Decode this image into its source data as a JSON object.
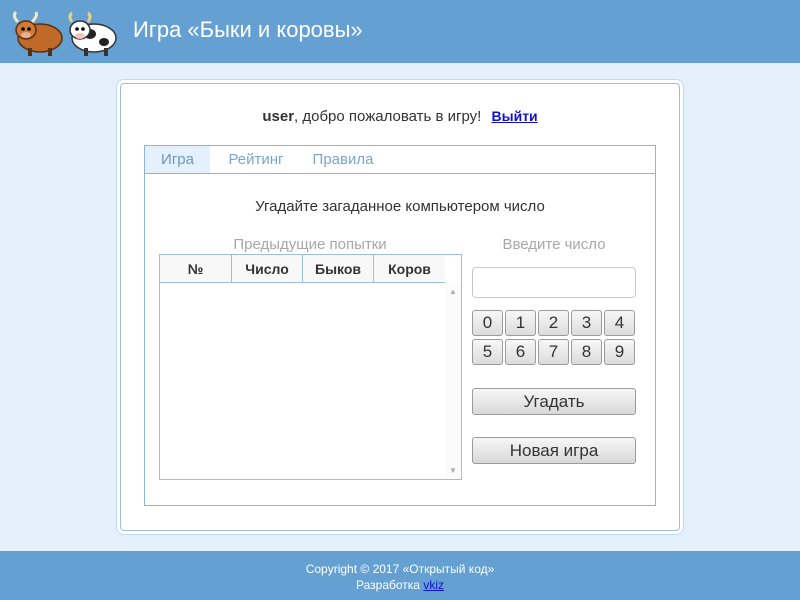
{
  "header": {
    "title": "Игра «Быки и коровы»",
    "logo_icon": "bull-and-cow-logo"
  },
  "welcome": {
    "username": "user",
    "message": ", добро пожаловать в игру!",
    "logout_label": "Выйти"
  },
  "tabs": [
    {
      "label": "Игра",
      "active": true
    },
    {
      "label": "Рейтинг",
      "active": false
    },
    {
      "label": "Правила",
      "active": false
    }
  ],
  "game": {
    "instruction": "Угадайте загаданное компьютером число",
    "previous_label": "Предыдущие попытки",
    "columns": [
      "№",
      "Число",
      "Быков",
      "Коров"
    ],
    "rows": [],
    "enter_label": "Введите число",
    "input_value": "",
    "keys": [
      "0",
      "1",
      "2",
      "3",
      "4",
      "5",
      "6",
      "7",
      "8",
      "9"
    ],
    "guess_label": "Угадать",
    "new_game_label": "Новая игра"
  },
  "footer": {
    "copyright": "Copyright © 2017 «Открытый код»",
    "dev_prefix": "Разработка",
    "dev_link": "vkiz"
  },
  "colors": {
    "header_bg": "#64a1d2",
    "page_bg": "#e4f0fb",
    "link": "#1010cc"
  }
}
